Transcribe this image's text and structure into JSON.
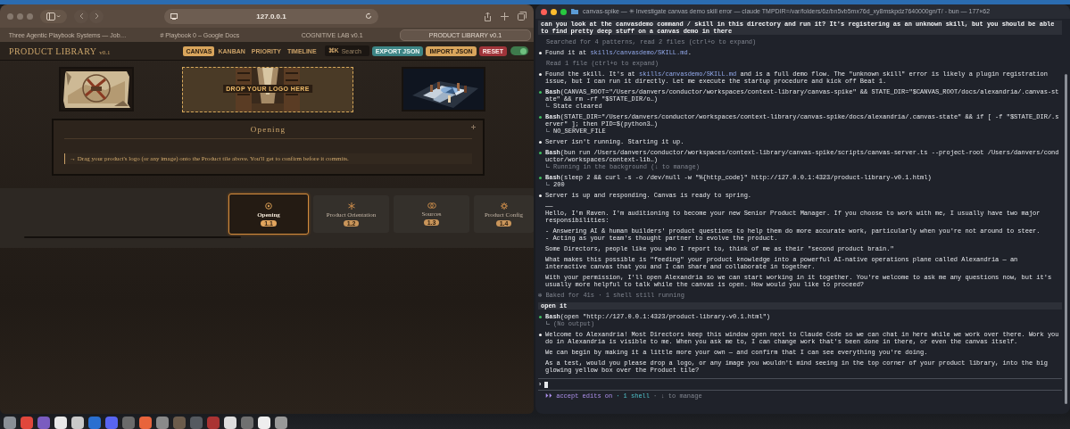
{
  "browser": {
    "url": "127.0.0.1",
    "tabs": [
      {
        "title": "Three Agentic Playbook Systems — Job…",
        "selected": false
      },
      {
        "title": "# Playbook 0 – Google Docs",
        "selected": false
      },
      {
        "title": "COGNITIVE LAB v0.1",
        "selected": false
      },
      {
        "title": "PRODUCT LIBRARY v0.1",
        "selected": true
      }
    ],
    "app": {
      "title": "PRODUCT LIBRARY",
      "version": "v0.1",
      "views": [
        {
          "label": "CANVAS",
          "selected": true
        },
        {
          "label": "KANBAN",
          "selected": false
        },
        {
          "label": "PRIORITY",
          "selected": false
        },
        {
          "label": "TIMELINE",
          "selected": false
        }
      ],
      "search": {
        "shortcut": "⌘K",
        "placeholder": "Search"
      },
      "actions": [
        {
          "label": "EXPORT JSON",
          "kind": "export"
        },
        {
          "label": "IMPORT JSON",
          "kind": "import"
        },
        {
          "label": "RESET",
          "kind": "reset"
        }
      ],
      "toggle": {
        "on": true
      },
      "tiles": [
        {
          "kind": "picture"
        },
        {
          "kind": "dropzone",
          "label": "DROP YOUR LOGO HERE"
        },
        {
          "kind": "picture"
        }
      ],
      "panel": {
        "title": "Opening",
        "hint": "→ Drag your product's logo (or any image) onto the Product tile above. You'll get to confirm before it commits."
      },
      "stages": [
        {
          "name": "Opening",
          "number": "1.1",
          "selected": true
        },
        {
          "name": "Product Orientation",
          "number": "1.2",
          "selected": false
        },
        {
          "name": "Sources",
          "number": "1.3",
          "selected": false
        },
        {
          "name": "Product Config",
          "number": "1.4",
          "selected": false
        }
      ]
    }
  },
  "terminal": {
    "title": "canvas-spike — ✳ Investigate canvas demo skill error — claude TMPDIR=/var/folders/6z/bn5vb5mx76d_xy8mskpdz7640000gn/T/ - bun — 177×62",
    "entries": [
      {
        "kind": "prompt",
        "text": "can you look at the canvasdemo command / skill in this directory and run it? It's registering as an unknown skill, but you should be able to find pretty deep stuff on a canvas demo in there"
      },
      {
        "kind": "note",
        "text": "Searched for 4 patterns, read 2 files (ctrl+o to expand)"
      },
      {
        "kind": "message",
        "paragraphs": [
          "Found it at **skills/canvasdemo/SKILL.md**."
        ]
      },
      {
        "kind": "note",
        "text": "Read 1 file (ctrl+o to expand)"
      },
      {
        "kind": "message",
        "paragraphs": [
          "Found the skill. It's at **skills/canvasdemo/SKILL.md** and is a full demo flow. The \"unknown skill\" error is likely a plugin registration issue, but I can run it directly. Let me execute the startup procedure and kick off Beat 1."
        ]
      },
      {
        "kind": "tool",
        "tool": "Bash",
        "args": "(CANVAS_ROOT=\"/Users/danvers/conductor/workspaces/context-library/canvas-spike\" && STATE_DIR=\"$CANVAS_ROOT/docs/alexandria/.canvas-state\" && rm -rf \"$STATE_DIR/o…)",
        "output": "State cleared",
        "output_muted": false
      },
      {
        "kind": "tool",
        "tool": "Bash",
        "args": "(STATE_DIR=\"/Users/danvers/conductor/workspaces/context-library/canvas-spike/docs/alexandria/.canvas-state\" && if [ -f \"$STATE_DIR/.server\" ]; then PID=$(python3…)",
        "output": "NO_SERVER_FILE",
        "output_muted": false
      },
      {
        "kind": "message",
        "paragraphs": [
          "Server isn't running. Starting it up."
        ]
      },
      {
        "kind": "tool",
        "tool": "Bash",
        "args": "(bun run /Users/danvers/conductor/workspaces/context-library/canvas-spike/scripts/canvas-server.ts --project-root /Users/danvers/conductor/workspaces/context-lib…)",
        "output": "Running in the background (↓ to manage)",
        "output_muted": true
      },
      {
        "kind": "tool",
        "tool": "Bash",
        "args": "(sleep 2 && curl -s -o /dev/null -w \"%{http_code}\" http://127.0.0.1:4323/product-library-v0.1.html)",
        "output": "200",
        "output_muted": false
      },
      {
        "kind": "message",
        "paragraphs": [
          "Server is up and responding. Canvas is ready to spring.",
          "——\nHello, I'm Raven. I'm auditioning to become your new Senior Product Manager. If you choose to work with me, I usually have two major responsibilities:",
          "- Answering AI & human builders' product questions to help them do more accurate work, particularly when you're not around to steer.\n- Acting as your team's thought partner to evolve the product.",
          "Some Directors, people like you who I report to, think of me as their \"second product brain.\"",
          "What makes this possible is \"feeding\" your product knowledge into a powerful AI-native operations plane called Alexandria — an interactive canvas that you and I can share and collaborate in together.",
          "With your permission, I'll open Alexandria so we can start working in it together. You're welcome to ask me any questions now, but it's usually more helpful to talk while the canvas is open. How would you like to proceed?"
        ]
      },
      {
        "kind": "status",
        "text": "✻ Baked for 41s · 1 shell still running"
      },
      {
        "kind": "prompt",
        "text": "open it"
      },
      {
        "kind": "tool",
        "tool": "Bash",
        "args": "(open \"http://127.0.0.1:4323/product-library-v0.1.html\")",
        "output": "(No output)",
        "output_muted": true
      },
      {
        "kind": "message",
        "paragraphs": [
          "Welcome to Alexandria! Most Directors keep this window open next to Claude Code so we can chat in here while we work over there. Work you do in Alexandria is visible to me. When you ask me to, I can change work that's been done in there, or even the canvas itself.",
          "We can begin by making it a little more your own — and confirm that I can see everything you're doing.",
          "As a test, would you please drop a logo, or any image you wouldn't mind seeing in the top corner of your product library, into the big glowing yellow box over the Product tile?"
        ]
      }
    ],
    "input": {
      "prompt_symbol": "›"
    },
    "status": [
      {
        "text": "⏵⏵ accept edits on",
        "kind": "mode"
      },
      {
        "text": "· 1 shell",
        "kind": "shells"
      },
      {
        "text": "· ↓ to manage",
        "kind": "hint"
      }
    ]
  }
}
